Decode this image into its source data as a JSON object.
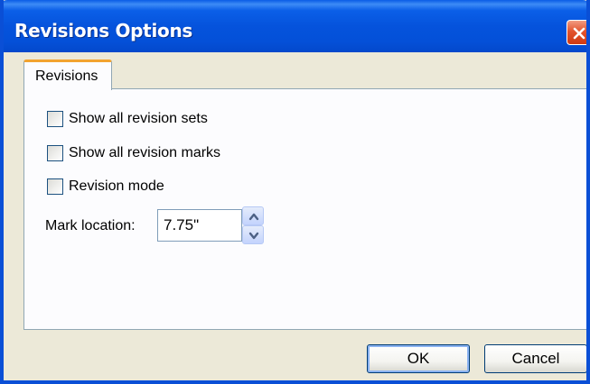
{
  "window": {
    "title": "Revisions Options"
  },
  "tabs": [
    {
      "label": "Revisions",
      "selected": true
    }
  ],
  "options": {
    "show_all_revision_sets": {
      "label": "Show all revision sets",
      "checked": false
    },
    "show_all_revision_marks": {
      "label": "Show all revision marks",
      "checked": false
    },
    "revision_mode": {
      "label": "Revision mode",
      "checked": false
    }
  },
  "mark_location": {
    "label": "Mark location:",
    "value": "7.75\""
  },
  "buttons": {
    "ok": "OK",
    "cancel": "Cancel"
  },
  "colors": {
    "titlebar": "#0553dc",
    "close_button": "#e2542e",
    "tab_highlight": "#f2a32f",
    "dialog_background": "#ece9d8"
  }
}
